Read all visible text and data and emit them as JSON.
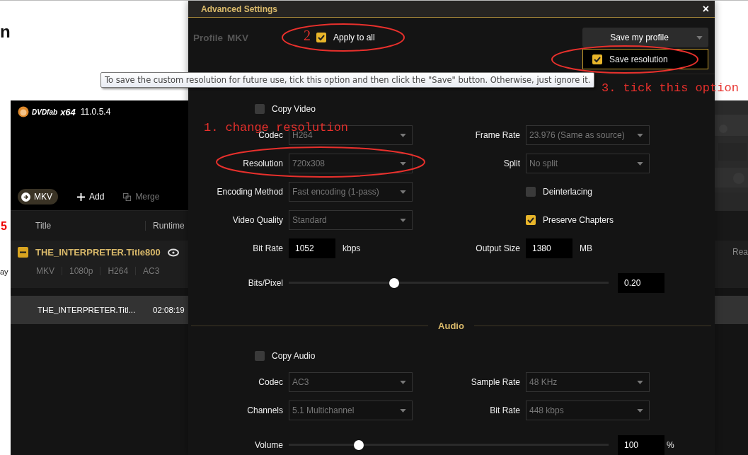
{
  "page": {
    "heading_fragment": "n",
    "number_fragment": "5",
    "text_fragment": "ay"
  },
  "app": {
    "logo": "DVDfab",
    "edition": "x64",
    "version": "11.0.5.4",
    "toolbar": [
      {
        "kind": "profile",
        "label": "MKV"
      },
      {
        "kind": "add",
        "label": "Add"
      },
      {
        "kind": "merge",
        "label": "Merge"
      }
    ],
    "columns": [
      "Title",
      "Runtime"
    ],
    "title": {
      "name": "THE_INTERPRETER.Title800",
      "expanded": true,
      "tags": [
        "MKV",
        "1080p",
        "H264",
        "AC3"
      ],
      "column_3": "Rea"
    },
    "rows": [
      {
        "title": "THE_INTERPRETER.Titl...",
        "runtime": "02:08:19",
        "selected": true
      }
    ]
  },
  "dialog": {
    "title": "Advanced Settings",
    "close": "×",
    "profile_label": "Profile",
    "profile_name": "MKV",
    "apply_to_all": {
      "label": "Apply to all",
      "checked": true
    },
    "save_button": "Save my profile",
    "save_resolution": {
      "label": "Save resolution",
      "checked": true
    },
    "video": {
      "rows": [
        {
          "kind": "check",
          "item": {
            "label": "Copy Video",
            "checked": false
          }
        },
        {
          "kind": "pair",
          "left": {
            "kind": "select",
            "label": "Codec",
            "value": "H264"
          },
          "right": {
            "kind": "select",
            "label": "Frame Rate",
            "value": "23.976 (Same as source)"
          }
        },
        {
          "kind": "pair",
          "left": {
            "kind": "select",
            "label": "Resolution",
            "value": "720x308"
          },
          "right": {
            "kind": "select",
            "label": "Split",
            "value": "No split"
          }
        },
        {
          "kind": "pair",
          "left": {
            "kind": "select",
            "label": "Encoding Method",
            "value": "Fast encoding (1-pass)"
          },
          "right": {
            "kind": "checkbox",
            "label": "Deinterlacing",
            "checked": false
          }
        },
        {
          "kind": "pair",
          "left": {
            "kind": "select",
            "label": "Video Quality",
            "value": "Standard"
          },
          "right": {
            "kind": "checkbox",
            "label": "Preserve Chapters",
            "checked": true
          }
        },
        {
          "kind": "pair",
          "left": {
            "kind": "number",
            "label": "Bit Rate",
            "value": "1052",
            "unit": "kbps"
          },
          "right": {
            "kind": "number",
            "label": "Output Size",
            "value": "1380",
            "unit": "MB"
          }
        },
        {
          "kind": "slider",
          "label": "Bits/Pixel",
          "level": 0.33,
          "value": "0.20"
        }
      ]
    },
    "audio": {
      "heading": "Audio",
      "rows": [
        {
          "kind": "check",
          "item": {
            "label": "Copy Audio",
            "checked": false
          }
        },
        {
          "kind": "pair",
          "left": {
            "kind": "select",
            "label": "Codec",
            "value": "AC3"
          },
          "right": {
            "kind": "select",
            "label": "Sample Rate",
            "value": "48 KHz"
          }
        },
        {
          "kind": "pair",
          "left": {
            "kind": "select",
            "label": "Channels",
            "value": "5.1 Multichannel"
          },
          "right": {
            "kind": "select",
            "label": "Bit Rate",
            "value": "448 kbps"
          }
        },
        {
          "kind": "slider",
          "label": "Volume",
          "level": 0.22,
          "value": "100",
          "unit": "%"
        }
      ]
    }
  },
  "tooltip": "To save the custom resolution for future use, tick this option and then click the \"Save\" button. Otherwise, just ignore it.",
  "annotations": [
    {
      "text": "2"
    },
    {
      "text": "1. change resolution"
    },
    {
      "text": "3. tick this option"
    }
  ]
}
